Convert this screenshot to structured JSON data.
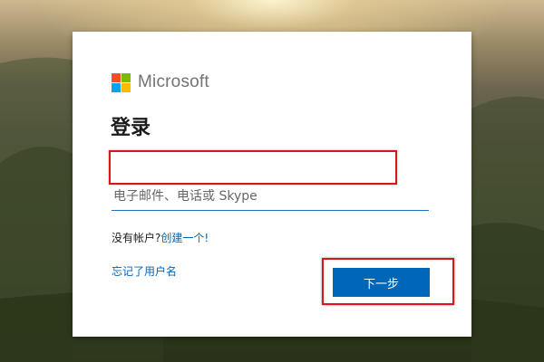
{
  "brand": {
    "name": "Microsoft",
    "logo_colors": [
      "#f25022",
      "#7fba00",
      "#00a4ef",
      "#ffb900"
    ]
  },
  "signin": {
    "title": "登录",
    "email_placeholder": "电子邮件、电话或 Skype",
    "email_value": "",
    "no_account_text": "没有帐户?",
    "create_link": "创建一个!",
    "forgot_username": "忘记了用户名",
    "next_button": "下一步"
  },
  "colors": {
    "accent": "#0067b8",
    "highlight": "#d9161c"
  }
}
